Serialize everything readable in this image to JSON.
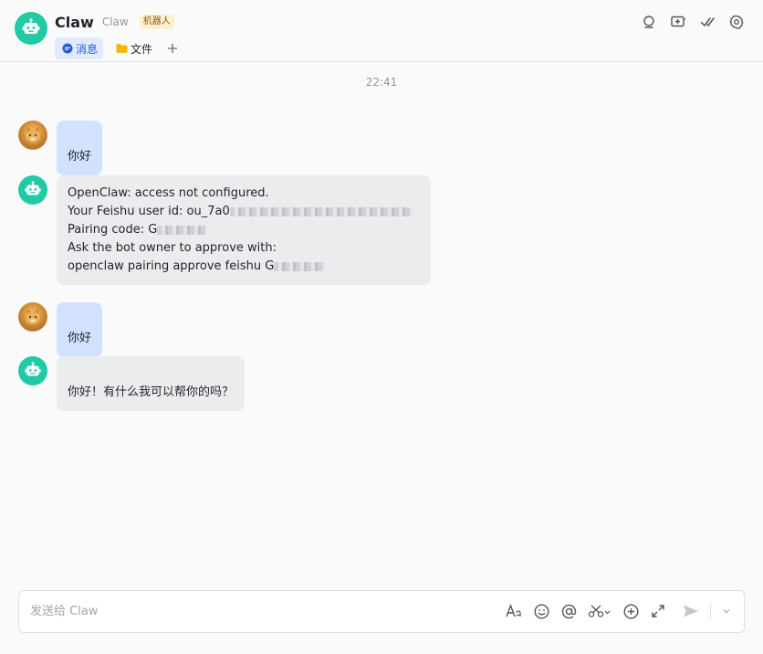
{
  "header": {
    "title": "Claw",
    "subtitle": "Claw",
    "badge": "机器人",
    "tabs": [
      {
        "label": "消息",
        "icon": "chat-bubble-icon"
      },
      {
        "label": "文件",
        "icon": "folder-icon"
      }
    ],
    "toolbar_icons": [
      "search-icon",
      "new-topic-icon",
      "check-icon",
      "settings-icon"
    ]
  },
  "chat": {
    "timestamp": "22:41",
    "messages": [
      {
        "sender": "user",
        "lines": [
          "你好"
        ]
      },
      {
        "sender": "bot",
        "lines": [
          "OpenClaw: access not configured.",
          "Your Feishu user id: ou_7a0",
          "Pairing code: G",
          "Ask the bot owner to approve with:",
          "openclaw pairing approve feishu G"
        ]
      },
      {
        "sender": "user",
        "lines": [
          "你好"
        ]
      },
      {
        "sender": "bot",
        "lines": [
          "你好！有什么我可以帮你的吗？"
        ]
      }
    ]
  },
  "composer": {
    "placeholder": "发送给 Claw",
    "tools": [
      "text-format-icon",
      "emoji-icon",
      "mention-icon",
      "screenshot-icon",
      "add-icon",
      "expand-icon",
      "send-icon",
      "chevron-down-icon"
    ]
  },
  "colors": {
    "bot_avatar": "#1fcaa4",
    "user_bubble": "#d2e2fe",
    "bot_bubble": "#ebecee",
    "active_tab": "#e1eaff",
    "accent": "#245bdb"
  }
}
